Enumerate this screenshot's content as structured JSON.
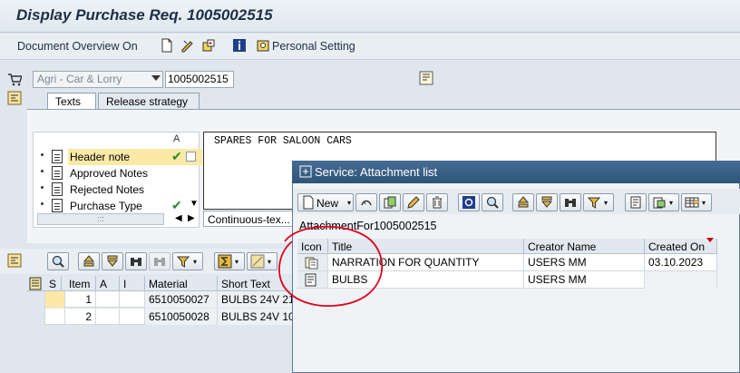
{
  "window": {
    "title": "Display Purchase Req. 1005002515"
  },
  "toolbar": {
    "doc_overview_label": "Document Overview On",
    "personal_setting_label": "Personal Setting"
  },
  "header": {
    "doc_type_value": "Agri -  Car & Lorry",
    "doc_number_value": "1005002515"
  },
  "tabs": [
    {
      "label": "Texts",
      "active": true
    },
    {
      "label": "Release strategy",
      "active": false
    }
  ],
  "text_types": {
    "col_header": "A",
    "items": [
      {
        "label": "Header note",
        "selected": true,
        "checked": true
      },
      {
        "label": "Approved Notes",
        "selected": false,
        "checked": false
      },
      {
        "label": "Rejected Notes",
        "selected": false,
        "checked": false
      },
      {
        "label": "Purchase Type",
        "selected": false,
        "checked": true
      }
    ],
    "scroll_grip": ":::"
  },
  "editor": {
    "text": "SPARES FOR SALOON CARS",
    "format_value": "Continuous-tex..."
  },
  "items_table": {
    "headers": [
      "S",
      "Item",
      "A",
      "I",
      "Material",
      "Short Text"
    ],
    "rows": [
      {
        "item": "1",
        "material": "6510050027",
        "short_text": "BULBS 24V 21"
      },
      {
        "item": "2",
        "material": "6510050028",
        "short_text": "BULBS 24V 10"
      }
    ]
  },
  "dialog": {
    "title": "Service: Attachment list",
    "new_label": "New",
    "caption": "AttachmentFor1005002515",
    "headers": [
      "Icon",
      "Title",
      "Creator Name",
      "Created On"
    ],
    "rows": [
      {
        "icon": "multi-doc-icon",
        "title": "NARRATION FOR QUANTITY",
        "creator": "USERS MM",
        "created_on": "03.10.2023"
      },
      {
        "icon": "note-doc-icon",
        "title": "BULBS",
        "creator": "USERS MM",
        "created_on": ""
      }
    ]
  },
  "colors": {
    "selection": "#fce9a6",
    "dialog_title": "#2e5479",
    "annotation": "#e0001a"
  }
}
